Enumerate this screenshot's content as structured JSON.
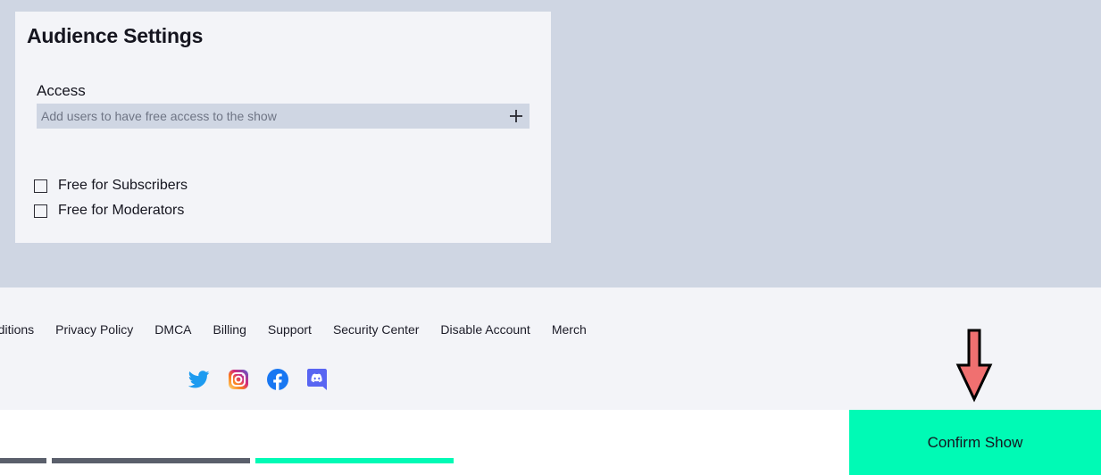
{
  "audience": {
    "title": "Audience Settings",
    "access_label": "Access",
    "access_placeholder": "Add users to have free access to the show",
    "add_icon": "plus-icon",
    "options": [
      {
        "label": "Free for Subscribers",
        "checked": false
      },
      {
        "label": "Free for Moderators",
        "checked": false
      }
    ]
  },
  "footer": {
    "links": [
      "Conditions",
      "Privacy Policy",
      "DMCA",
      "Billing",
      "Support",
      "Security Center",
      "Disable Account",
      "Merch"
    ],
    "social": [
      "twitter-icon",
      "instagram-icon",
      "facebook-icon",
      "discord-icon"
    ]
  },
  "bottom": {
    "progress": [
      {
        "state": "done",
        "color": "#5a5f6b"
      },
      {
        "state": "done",
        "color": "#5a5f6b"
      },
      {
        "state": "current",
        "color": "#00fab5"
      }
    ],
    "confirm_label": "Confirm Show"
  },
  "colors": {
    "accent": "#00fab5",
    "page_bg": "#cfd6e3",
    "card_bg": "#f3f4f8",
    "annotation_arrow": "#f07070"
  }
}
